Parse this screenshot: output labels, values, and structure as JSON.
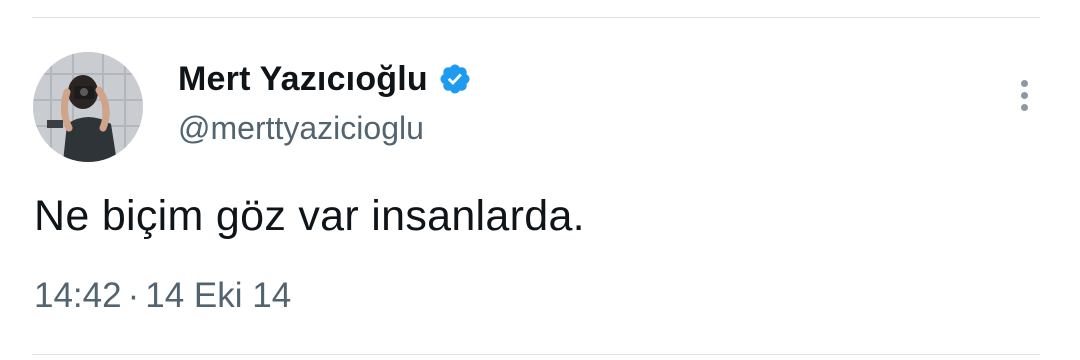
{
  "tweet": {
    "author": {
      "display_name": "Mert Yazıcıoğlu",
      "handle": "@merttyazicioglu",
      "verified": true,
      "verified_icon": "verified-badge-icon",
      "avatar_icon": "avatar-photographer-photo"
    },
    "text": "Ne biçim göz var insanlarda.",
    "time": "14:42",
    "separator": "·",
    "date": "14 Eki 14",
    "more_icon": "more-options-icon"
  },
  "colors": {
    "text_primary": "#0f1419",
    "text_secondary": "#536471",
    "verified_blue": "#1d9bf0",
    "divider": "#dfe4e8"
  }
}
